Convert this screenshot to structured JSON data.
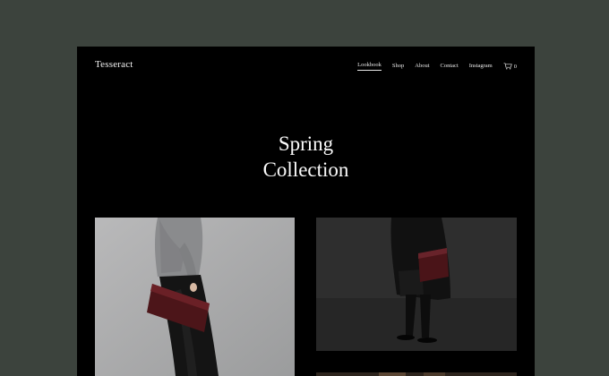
{
  "brand": "Tesseract",
  "nav": {
    "items": [
      {
        "label": "Lookbook",
        "active": true
      },
      {
        "label": "Shop",
        "active": false
      },
      {
        "label": "About",
        "active": false
      },
      {
        "label": "Contact",
        "active": false
      },
      {
        "label": "Instagram",
        "active": false
      }
    ],
    "cart_icon": "cart-icon",
    "cart_count": "0"
  },
  "hero": {
    "line1": "Spring",
    "line2": "Collection"
  },
  "gallery": [
    {
      "subject": "model in grey sweater holding burgundy clutch"
    },
    {
      "subject": "model in black coat holding burgundy clutch"
    },
    {
      "subject": "partially visible photo"
    }
  ],
  "colors": {
    "backdrop": "#3c433d",
    "page": "#000000",
    "text": "#f2f2f2",
    "accent_bag": "#5a1a1e"
  }
}
